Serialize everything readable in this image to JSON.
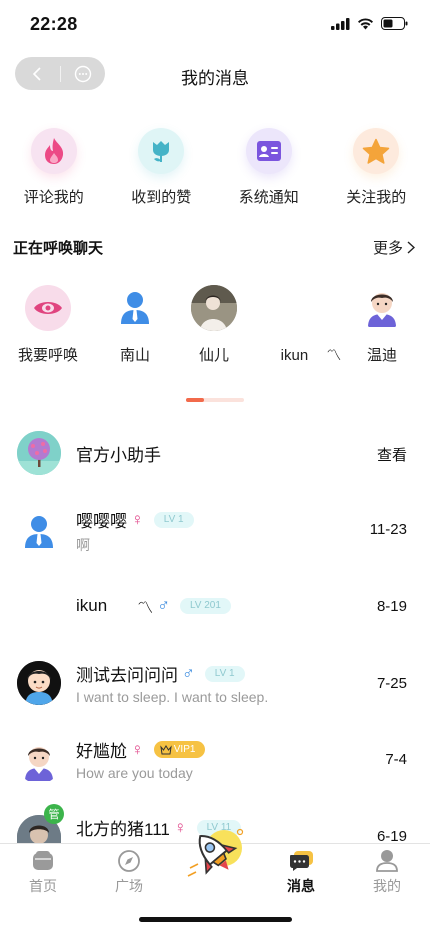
{
  "status": {
    "time": "22:28"
  },
  "nav": {
    "title": "我的消息"
  },
  "quick": [
    {
      "label": "评论我的",
      "icon": "flame-icon",
      "bg": "#f7e3f1",
      "color": "#ec4a86"
    },
    {
      "label": "收到的赞",
      "icon": "tulip-icon",
      "bg": "#dff5f6",
      "color": "#45b3c7"
    },
    {
      "label": "系统通知",
      "icon": "id-card-icon",
      "bg": "#ece6fb",
      "color": "#7b55de"
    },
    {
      "label": "关注我的",
      "icon": "star-icon",
      "bg": "#fdeadd",
      "color": "#f4a43a"
    }
  ],
  "calling": {
    "title": "正在呼唤聊天",
    "more": "更多",
    "items": [
      {
        "label": "我要呼唤",
        "icon": "eye-icon"
      },
      {
        "label": "南山",
        "icon": "person-icon"
      },
      {
        "label": "仙儿",
        "icon": "photo-avatar"
      },
      {
        "label": "ikun",
        "extra": "〽"
      },
      {
        "label": "温迪",
        "icon": "boy-avatar"
      }
    ]
  },
  "messages": [
    {
      "name": "官方小助手",
      "action": "查看"
    },
    {
      "name": "嘤嘤嘤",
      "gender": "♀",
      "level": "LV 1",
      "sub": "啊",
      "date": "11-23"
    },
    {
      "name": "ikun",
      "extra": "〽",
      "gender": "♂",
      "level": "LV 201",
      "date": "8-19"
    },
    {
      "name": "测试去问问问",
      "gender": "♂",
      "level": "LV 1",
      "sub": "I want to sleep. I want to sleep.",
      "date": "7-25"
    },
    {
      "name": "好尴尬",
      "gender": "♀",
      "vip": "VIP1",
      "sub": "How are you today",
      "date": "7-4"
    },
    {
      "name": "北方的猪111",
      "gender": "♀",
      "level": "LV 11",
      "date": "6-19",
      "badge": "管"
    }
  ],
  "tabs": [
    {
      "label": "首页"
    },
    {
      "label": "广场"
    },
    {
      "label": "消息",
      "active": true
    },
    {
      "label": "我的"
    }
  ],
  "colors": {
    "female": "#e0478a",
    "male": "#3a8bdf",
    "accent": "#f26a4b"
  }
}
